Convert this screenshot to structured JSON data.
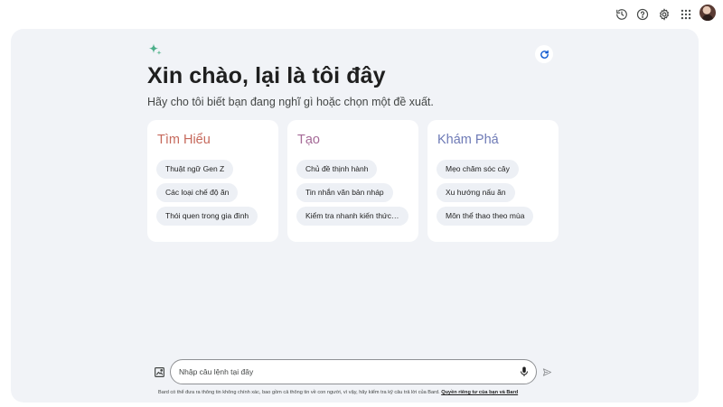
{
  "colors": {
    "panel_bg": "#f1f3f7",
    "card_bg": "#ffffff",
    "chip_bg": "#edf0f5",
    "learn_title": "#c6695c",
    "create_title": "#a56a97",
    "explore_title": "#6e7ab6",
    "refresh_accent": "#0b57d0",
    "sparkle_accent": "#4caf8a"
  },
  "topbar": {
    "icons": [
      "history-icon",
      "help-icon",
      "settings-icon",
      "apps-grid-icon",
      "avatar"
    ]
  },
  "main": {
    "greeting": "Xin chào, lại là tôi đây",
    "subtitle": "Hãy cho tôi biết bạn đang nghĩ gì hoặc chọn một đề xuất.",
    "refresh_icon": "refresh-icon",
    "sparkle_icon": "sparkle-icon"
  },
  "cards": [
    {
      "title": "Tìm Hiểu",
      "chips": [
        "Thuật ngữ Gen Z",
        "Các loại chế độ ăn",
        "Thói quen trong gia đình"
      ]
    },
    {
      "title": "Tạo",
      "chips": [
        "Chủ đề thịnh hành",
        "Tin nhắn văn bản nháp",
        "Kiểm tra nhanh kiến thức v…"
      ]
    },
    {
      "title": "Khám Phá",
      "chips": [
        "Mẹo chăm sóc cây",
        "Xu hướng nấu ăn",
        "Môn thể thao theo mùa"
      ]
    }
  ],
  "prompt": {
    "placeholder": "Nhập câu lệnh tại đây",
    "value": "",
    "image_icon": "add-image-icon",
    "mic_icon": "microphone-icon",
    "send_icon": "send-icon"
  },
  "footer": {
    "disclaimer": "Bard có thể đưa ra thông tin không chính xác, bao gồm cả thông tin về con người, vì vậy, hãy kiểm tra kỹ câu trả lời của Bard.",
    "privacy_link": "Quyền riêng tư của bạn và Bard"
  }
}
